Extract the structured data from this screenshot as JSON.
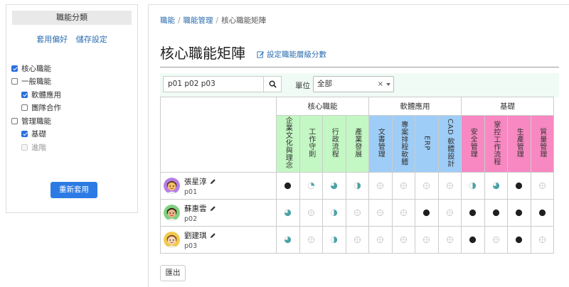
{
  "sidebar": {
    "header": "職能分類",
    "links": [
      "套用偏好",
      "儲存設定"
    ],
    "tree": [
      {
        "label": "核心職能",
        "checked": true,
        "child": false,
        "disabled": false
      },
      {
        "label": "一般職能",
        "checked": false,
        "child": false,
        "disabled": false
      },
      {
        "label": "軟體應用",
        "checked": true,
        "child": true,
        "disabled": false
      },
      {
        "label": "團隊合作",
        "checked": false,
        "child": true,
        "disabled": false
      },
      {
        "label": "管理職能",
        "checked": false,
        "child": false,
        "disabled": false
      },
      {
        "label": "基礎",
        "checked": true,
        "child": true,
        "disabled": false
      },
      {
        "label": "進階",
        "checked": false,
        "child": true,
        "disabled": true
      }
    ],
    "reset_label": "重新套用"
  },
  "breadcrumb": {
    "items": [
      "職能",
      "職能管理",
      "核心職能矩陣"
    ]
  },
  "page": {
    "title": "核心職能矩陣",
    "edit_link": "設定職能層級分數"
  },
  "filter": {
    "search_value": "p01 p02 p03",
    "unit_label": "單位",
    "unit_value": "全部",
    "clear_glyph": "×"
  },
  "matrix": {
    "groups": [
      {
        "label": "核心職能",
        "span": 4,
        "color": "#c3f7c3"
      },
      {
        "label": "軟體應用",
        "span": 4,
        "color": "#9ecdf7"
      },
      {
        "label": "基礎",
        "span": 4,
        "color": "#f788c2"
      }
    ],
    "columns": [
      "企業文化與理念",
      "工作守則",
      "行政流程",
      "產業發展",
      "文書管理",
      "專案排程軟體",
      "ERP",
      "CAD 軟體設計",
      "安全管理",
      "掌控工作流程",
      "生產管理",
      "質量管理"
    ],
    "people": [
      {
        "name": "張星淳",
        "id": "p01",
        "avatar": "purple",
        "levels": [
          4,
          1,
          3,
          2,
          0,
          0,
          0,
          0,
          2,
          3,
          4,
          0
        ]
      },
      {
        "name": "蘇惠雲",
        "id": "p02",
        "avatar": "green",
        "levels": [
          3,
          0,
          2,
          0,
          0,
          0,
          4,
          0,
          4,
          4,
          4,
          4
        ]
      },
      {
        "name": "劉建琪",
        "id": "p03",
        "avatar": "yellow",
        "levels": [
          3,
          0,
          2,
          0,
          0,
          0,
          0,
          0,
          4,
          0,
          4,
          0
        ]
      }
    ],
    "level_colors": {
      "teal": "#4aa3a8",
      "dark": "#1f1f1f"
    }
  },
  "export_label": "匯出"
}
